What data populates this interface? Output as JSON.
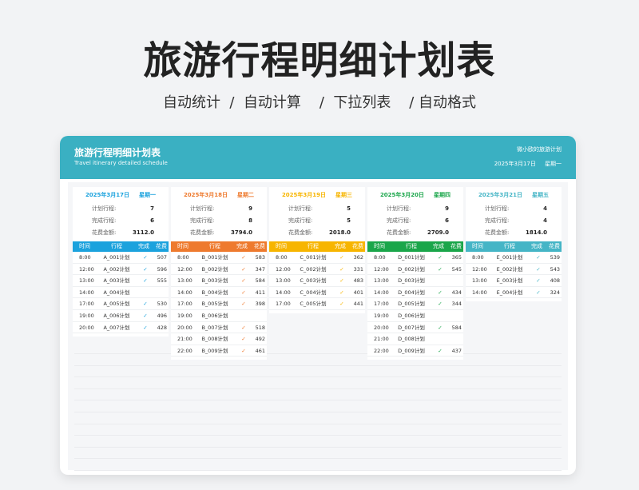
{
  "hero": {
    "title": "旅游行程明细计划表",
    "subtitle": "自动统计  /  自动计算    /  下拉列表    / 自动格式"
  },
  "sheet": {
    "title": "旅游行程明细计划表",
    "subtitle_en": "Travel itinerary detailed schedule",
    "note": "微小欧的旅游计划",
    "date_line": "2025年3月17日     星期一"
  },
  "labels": {
    "planned": "计划行程:",
    "completed": "完成行程:",
    "cost": "花费金额:",
    "col_time": "时间",
    "col_trip": "行程",
    "col_done": "完成",
    "col_cost": "花费"
  },
  "check_mark": "✓",
  "days": [
    {
      "date": "2025年3月17日",
      "weekday": "星期一",
      "color": "#1ba2dd",
      "planned": "7",
      "completed": "6",
      "cost": "3112.0",
      "rows": [
        {
          "time": "8:00",
          "trip": "A_001计划",
          "done": true,
          "cost": "507"
        },
        {
          "time": "12:00",
          "trip": "A_002计划",
          "done": true,
          "cost": "596"
        },
        {
          "time": "13:00",
          "trip": "A_003计划",
          "done": true,
          "cost": "555"
        },
        {
          "time": "14:00",
          "trip": "A_004计划",
          "done": false,
          "cost": ""
        },
        {
          "time": "17:00",
          "trip": "A_005计划",
          "done": true,
          "cost": "530"
        },
        {
          "time": "19:00",
          "trip": "A_006计划",
          "done": true,
          "cost": "496"
        },
        {
          "time": "20:00",
          "trip": "A_007计划",
          "done": true,
          "cost": "428"
        }
      ]
    },
    {
      "date": "2025年3月18日",
      "weekday": "星期二",
      "color": "#ee7a2e",
      "planned": "9",
      "completed": "8",
      "cost": "3794.0",
      "rows": [
        {
          "time": "8:00",
          "trip": "B_001计划",
          "done": true,
          "cost": "583"
        },
        {
          "time": "12:00",
          "trip": "B_002计划",
          "done": true,
          "cost": "347"
        },
        {
          "time": "13:00",
          "trip": "B_003计划",
          "done": true,
          "cost": "584"
        },
        {
          "time": "14:00",
          "trip": "B_004计划",
          "done": true,
          "cost": "411"
        },
        {
          "time": "17:00",
          "trip": "B_005计划",
          "done": true,
          "cost": "398"
        },
        {
          "time": "19:00",
          "trip": "B_006计划",
          "done": false,
          "cost": ""
        },
        {
          "time": "20:00",
          "trip": "B_007计划",
          "done": true,
          "cost": "518"
        },
        {
          "time": "21:00",
          "trip": "B_008计划",
          "done": true,
          "cost": "492"
        },
        {
          "time": "22:00",
          "trip": "B_009计划",
          "done": true,
          "cost": "461"
        }
      ]
    },
    {
      "date": "2025年3月19日",
      "weekday": "星期三",
      "color": "#f7b500",
      "planned": "5",
      "completed": "5",
      "cost": "2018.0",
      "rows": [
        {
          "time": "8:00",
          "trip": "C_001计划",
          "done": true,
          "cost": "362"
        },
        {
          "time": "12:00",
          "trip": "C_002计划",
          "done": true,
          "cost": "331"
        },
        {
          "time": "13:00",
          "trip": "C_003计划",
          "done": true,
          "cost": "483"
        },
        {
          "time": "14:00",
          "trip": "C_004计划",
          "done": true,
          "cost": "401"
        },
        {
          "time": "17:00",
          "trip": "C_005计划",
          "done": true,
          "cost": "441"
        }
      ]
    },
    {
      "date": "2025年3月20日",
      "weekday": "星期四",
      "color": "#1aa64a",
      "planned": "9",
      "completed": "6",
      "cost": "2709.0",
      "rows": [
        {
          "time": "8:00",
          "trip": "D_001计划",
          "done": true,
          "cost": "365"
        },
        {
          "time": "12:00",
          "trip": "D_002计划",
          "done": true,
          "cost": "545"
        },
        {
          "time": "13:00",
          "trip": "D_003计划",
          "done": false,
          "cost": ""
        },
        {
          "time": "14:00",
          "trip": "D_004计划",
          "done": true,
          "cost": "434"
        },
        {
          "time": "17:00",
          "trip": "D_005计划",
          "done": true,
          "cost": "344"
        },
        {
          "time": "19:00",
          "trip": "D_006计划",
          "done": false,
          "cost": ""
        },
        {
          "time": "20:00",
          "trip": "D_007计划",
          "done": true,
          "cost": "584"
        },
        {
          "time": "21:00",
          "trip": "D_008计划",
          "done": false,
          "cost": ""
        },
        {
          "time": "22:00",
          "trip": "D_009计划",
          "done": true,
          "cost": "437"
        }
      ]
    },
    {
      "date": "2025年3月21日",
      "weekday": "星期五",
      "color": "#45b5c6",
      "planned": "4",
      "completed": "4",
      "cost": "1814.0",
      "rows": [
        {
          "time": "8:00",
          "trip": "E_001计划",
          "done": true,
          "cost": "539"
        },
        {
          "time": "12:00",
          "trip": "E_002计划",
          "done": true,
          "cost": "543"
        },
        {
          "time": "13:00",
          "trip": "E_003计划",
          "done": true,
          "cost": "408"
        },
        {
          "time": "14:00",
          "trip": "E_004计划",
          "done": true,
          "cost": "324"
        }
      ]
    }
  ]
}
